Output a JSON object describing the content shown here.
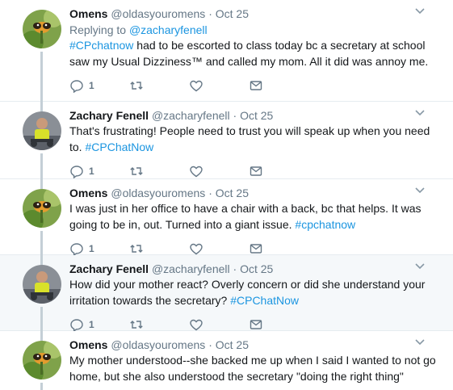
{
  "colors": {
    "link": "#1b95e0",
    "muted": "#657786",
    "highlight_bg": "#f5f8fa",
    "thread_line": "#c4cfd6"
  },
  "icons": {
    "reply": "reply-icon",
    "retweet": "retweet-icon",
    "like": "heart-icon",
    "dm": "envelope-icon",
    "more": "chevron-down-icon"
  },
  "tweets": [
    {
      "name": "Omens",
      "handle": "@oldasyouromens",
      "dot": "·",
      "time": "Oct 25",
      "replying_prefix": "Replying to ",
      "replying_to": "@zacharyfenell",
      "text_parts": {
        "hashtag_start": "#CPchatnow",
        "body": " had to be escorted to class today bc a secretary at school saw my Usual Dizziness™ and called my mom. All it did was annoy me."
      },
      "reply_count": "1"
    },
    {
      "name": "Zachary Fenell",
      "handle": "@zacharyfenell",
      "dot": "·",
      "time": "Oct 25",
      "text_parts": {
        "body": "That's frustrating! People need to trust you will speak up when you need to. ",
        "hashtag_end": "#CPChatNow"
      },
      "reply_count": "1"
    },
    {
      "name": "Omens",
      "handle": "@oldasyouromens",
      "dot": "·",
      "time": "Oct 25",
      "text_parts": {
        "body": "I was just in her office to have a chair with a back, bc that helps. It was going to be in, out. Turned into a giant issue. ",
        "hashtag_end": "#cpchatnow"
      },
      "reply_count": "1"
    },
    {
      "name": "Zachary Fenell",
      "handle": "@zacharyfenell",
      "dot": "·",
      "time": "Oct 25",
      "text_parts": {
        "body": "How did your mother react? Overly concern or did she understand your irritation towards the secretary? ",
        "hashtag_end": "#CPChatNow"
      },
      "reply_count": "1"
    },
    {
      "name": "Omens",
      "handle": "@oldasyouromens",
      "dot": "·",
      "time": "Oct 25",
      "text_parts": {
        "body": "My mother understood--she backed me up when I said I wanted to not go home, but she also understood the secretary \"doing the right thing\""
      }
    }
  ]
}
